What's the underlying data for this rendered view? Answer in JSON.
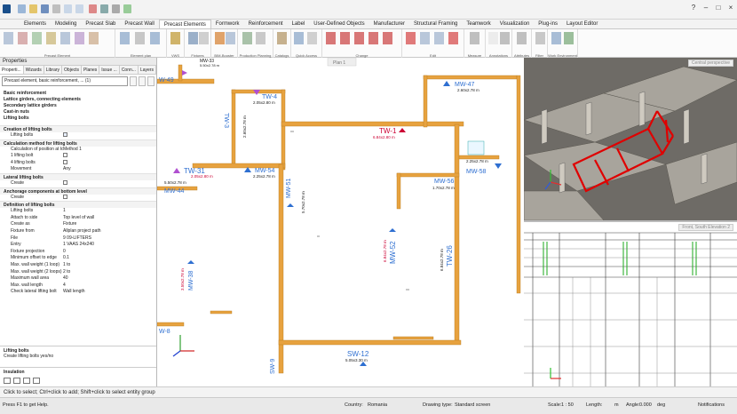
{
  "ribbon": {
    "tabs": [
      "Elements",
      "Modeling",
      "Precast Slab",
      "Precast Wall",
      "Precast Elements",
      "Formwork",
      "Reinforcement",
      "Label",
      "User-Defined Objects",
      "Manufacturer",
      "Structural Framing",
      "Teamwork",
      "Visualization",
      "Plug-ins",
      "Layout Editor"
    ],
    "active_tab": "Precast Elements",
    "groups": [
      "Precast Element",
      "Element plan",
      "VWS",
      "Fixtures",
      "BIM-Booster",
      "Production Planning",
      "Catalogs",
      "Quick Access",
      "Change",
      "Edit",
      "Measure",
      "Annotations",
      "Attributes",
      "Filter",
      "Work Environment"
    ]
  },
  "panel": {
    "title": "Properties",
    "tabs": [
      "Properti...",
      "Wizards",
      "Library",
      "Objects",
      "Planes",
      "Issue ...",
      "Conn...",
      "Layers"
    ],
    "element_select": "Precast element, basic reinforcement, ... (1)",
    "categories": [
      "Basic reinforcement",
      "Lattice girders, connecting elements",
      "Secondary lattice girders",
      "Cast-in nuts",
      "Lifting bolts"
    ],
    "sections": {
      "creation": "Creation of lifting bolts",
      "calc_method": "Calculation method for lifting bolts",
      "lateral": "Lateral lifting bolts",
      "anchorage": "Anchorage components at bottom level",
      "definition": "Definition of lifting bolts"
    },
    "rows": {
      "lifting_bolts": "Lifting bolts",
      "calc_pos": "Calculation of position at top",
      "calc_pos_val": "Method 1",
      "one_bolt": "1 lifting bolt",
      "four_bolt": "4 lifting bolts",
      "movement": "Movement",
      "movement_val": "Any",
      "create1": "Create",
      "create2": "Create",
      "def_lifting": "Lifting bolts",
      "def_lifting_val": "1",
      "attach": "Attach to side",
      "attach_val": "Top level of wall",
      "create_as": "Create as",
      "create_as_val": "Fixture",
      "fixture_from": "Fixture from",
      "fixture_from_val": "Allplan project path",
      "file": "File",
      "file_val": "9 09-LIFTERS",
      "entry": "Entry",
      "entry_val": "1 VAAS 24x240",
      "projection": "Fixture projection",
      "projection_val": "0",
      "min_offset": "Minimum offset to edge",
      "min_offset_val": "0.1",
      "mww1": "Max. wall weight (1 loop)",
      "mww1_val": "1 to",
      "mww2": "Max. wall weight (2 loops)",
      "mww2_val": "2 to",
      "max_area": "Maximum wall area",
      "max_area_val": "40",
      "max_length": "Max. wall length",
      "max_length_val": "4",
      "check_lateral": "Check lateral lifting bolt",
      "check_lateral_val": "Wall length"
    },
    "help_title": "Lifting bolts",
    "help_text": "Create lifting bolts yes/no",
    "insulation": "Insulation"
  },
  "plan": {
    "viewport_label": "Plan 1",
    "walls": [
      {
        "id": "MW-33",
        "dims": "5.50x2.78 m"
      },
      {
        "id": "W-49",
        "dims": ""
      },
      {
        "id": "TW-4",
        "dims": "2.05x2.80 m"
      },
      {
        "id": "TW-3",
        "dims": "2.60x2.78 m"
      },
      {
        "id": "MW-47",
        "dims": "2.60x2.78 m"
      },
      {
        "id": "TW-1",
        "dims": "6.84x2.80 m"
      },
      {
        "id": "TW-31",
        "dims": "2.05x2.80 m"
      },
      {
        "id": "MW-54",
        "dims": "2.25x2.78 m"
      },
      {
        "id": "MW-44",
        "dims": "5.50x2.78 m"
      },
      {
        "id": "MW-56",
        "dims": "1.70x2.78 m"
      },
      {
        "id": "MW-51",
        "dims": "5.70x2.78 m"
      },
      {
        "id": "MW-52",
        "dims": "6.84x2.78 m"
      },
      {
        "id": "TW-26",
        "dims": "6.84x2.78 m"
      },
      {
        "id": "MW-38",
        "dims": "3.50x2.78 m"
      },
      {
        "id": "W-8",
        "dims": ""
      },
      {
        "id": "SW-9",
        "dims": ""
      },
      {
        "id": "SW-12",
        "dims": "5.05x3.30 m"
      },
      {
        "id": "MW-58",
        "dims": "2.25x2.78 m"
      }
    ]
  },
  "view3d": {
    "label": "Central perspective"
  },
  "elevation": {
    "label": "Front, South Elevation 2"
  },
  "command_bar": "Click to select; Ctrl+click to add; Shift+click to select entity group",
  "status": {
    "help": "Press F1 to get Help.",
    "country_label": "Country:",
    "country": "Romania",
    "drawing_type_label": "Drawing type:",
    "drawing_type": "Standard screen",
    "scale_label": "Scale:",
    "scale": "1 : 50",
    "length_label": "Length:",
    "length": "m",
    "angle_label": "Angle:",
    "angle": "0.000",
    "angle_unit": "deg",
    "notifications": "Notifications"
  },
  "colors": {
    "wall": "#e7a23f",
    "annotation": "#cc0033",
    "blue": "#2e6fd1",
    "frame_red": "#e00000"
  }
}
